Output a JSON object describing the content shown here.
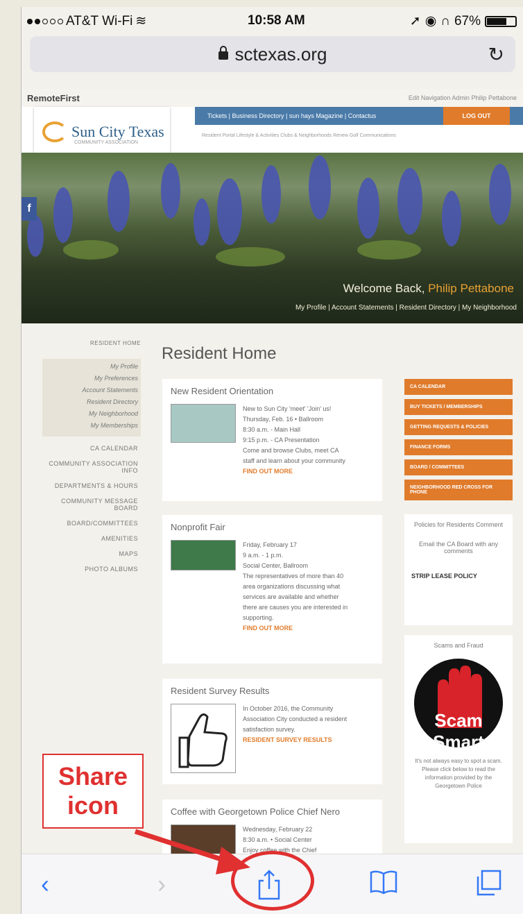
{
  "status": {
    "carrier": "AT&T Wi-Fi",
    "time": "10:58 AM",
    "battery": "67%",
    "battery_level": 0.67
  },
  "address_bar": {
    "domain": "sctexas.org"
  },
  "site": {
    "topbar_brand": "RemoteFirst",
    "topbar_right": "Edit Navigation   Admin   Philip Pettabone",
    "nav_links": "Tickets | Business Directory | sun hays Magazine | Contactus",
    "logout": "LOG OUT",
    "subnav": "Resident Portal  Lifestyle & Activities  Clubs & Neighborhoods  Renew  Golf  Communications",
    "logo_text": "Sun City Texas",
    "logo_sub": "COMMUNITY ASSOCIATION",
    "facebook": "f",
    "welcome_prefix": "Welcome Back, ",
    "welcome_name": "Philip Pettabone",
    "hero_links": "My Profile | Account Statements | Resident Directory | My Neighborhood"
  },
  "sidebar": {
    "home": "RESIDENT HOME",
    "sub_items": [
      "My Profile",
      "My Preferences",
      "Account Statements",
      "Resident Directory",
      "My Neighborhood",
      "My Memberships"
    ],
    "main_items": [
      "CA CALENDAR",
      "COMMUNITY ASSOCIATION INFO",
      "DEPARTMENTS & HOURS",
      "COMMUNITY MESSAGE BOARD",
      "BOARD/COMMITTEES",
      "AMENITIES",
      "MAPS",
      "PHOTO ALBUMS"
    ]
  },
  "main": {
    "title": "Resident Home",
    "cards": [
      {
        "title": "New Resident Orientation",
        "lines": [
          "New to Sun City 'meet' 'Join' us!",
          "Thursday, Feb. 16 • Ballroom",
          "8:30 a.m. - Main Hall",
          "9:15 p.m. - CA Presentation",
          "Come and browse Clubs, meet CA",
          "staff and learn about your community"
        ],
        "link": "FIND OUT MORE"
      },
      {
        "title": "Nonprofit Fair",
        "lines": [
          "Friday, February 17",
          "9 a.m. - 1 p.m.",
          "Social Center, Ballroom",
          "The representatives of more than 40",
          "area organizations discussing what",
          "services are available and whether",
          "there are causes you are interested in",
          "supporting."
        ],
        "link": "FIND OUT MORE"
      },
      {
        "title": "Resident Survey Results",
        "lines": [
          "In October 2016, the Community",
          "Association City conducted a resident",
          "satisfaction survey."
        ],
        "link": "RESIDENT SURVEY RESULTS"
      },
      {
        "title": "Coffee with Georgetown Police Chief Nero",
        "lines": [
          "Wednesday, February 22",
          "8:30 a.m. • Social Center",
          "Enjoy coffee with the Chief"
        ],
        "link": ""
      }
    ]
  },
  "rightcol": {
    "buttons": [
      "CA CALENDAR",
      "BUY TICKETS / MEMBERSHIPS",
      "GETTING REQUESTS & POLICIES",
      "FINANCE FORMS",
      "BOARD / COMMITTEES",
      "NEIGHBORHOOD RED CROSS FOR PHONE"
    ],
    "policy_title": "Policies for Residents Comment",
    "policy_text": "Email the CA Board with any comments",
    "policy_link": "STRIP LEASE POLICY",
    "scam_title": "Scams and Fraud",
    "scam_badge": "Scam Smart",
    "scam_text": "It's not always easy to spot a scam. Please click below to read the information provided by the Georgetown Police"
  },
  "annotation": {
    "line1": "Share",
    "line2": "icon"
  },
  "toolbar": {
    "icons": [
      "back-icon",
      "forward-icon",
      "share-icon",
      "bookmarks-icon",
      "tabs-icon"
    ]
  },
  "colors": {
    "accent": "#e07b2b",
    "nav_blue": "#4a7aa8",
    "ios_blue": "#3478f6",
    "annotation_red": "#e03030"
  }
}
